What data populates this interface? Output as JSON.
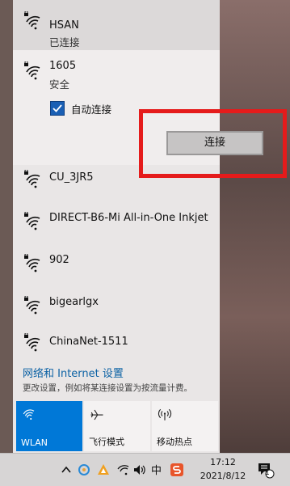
{
  "networks": [
    {
      "name": "HSAN",
      "status": "已连接"
    },
    {
      "name": "1605",
      "status": "安全",
      "auto_connect_label": "自动连接",
      "auto_connect_checked": true,
      "connect_label": "连接"
    },
    {
      "name": "CU_3JR5"
    },
    {
      "name": "DIRECT-B6-Mi All-in-One Inkjet"
    },
    {
      "name": "902"
    },
    {
      "name": "bigearlgx"
    },
    {
      "name": "ChinaNet-1511"
    }
  ],
  "settings": {
    "link_label": "网络和 Internet 设置",
    "description": "更改设置，例如将某连接设置为按流量计费。"
  },
  "quick_actions": [
    {
      "label": "WLAN",
      "icon": "wifi-icon",
      "active": true
    },
    {
      "label": "飞行模式",
      "icon": "airplane-icon",
      "active": false
    },
    {
      "label": "移动热点",
      "icon": "hotspot-icon",
      "active": false
    }
  ],
  "taskbar": {
    "time": "17:12",
    "date": "2021/8/12",
    "ime_label": "中",
    "notification_count": "1"
  },
  "colors": {
    "accent": "#0078d7",
    "highlight_box": "#e51b1b",
    "checkbox": "#1a5fb4"
  }
}
